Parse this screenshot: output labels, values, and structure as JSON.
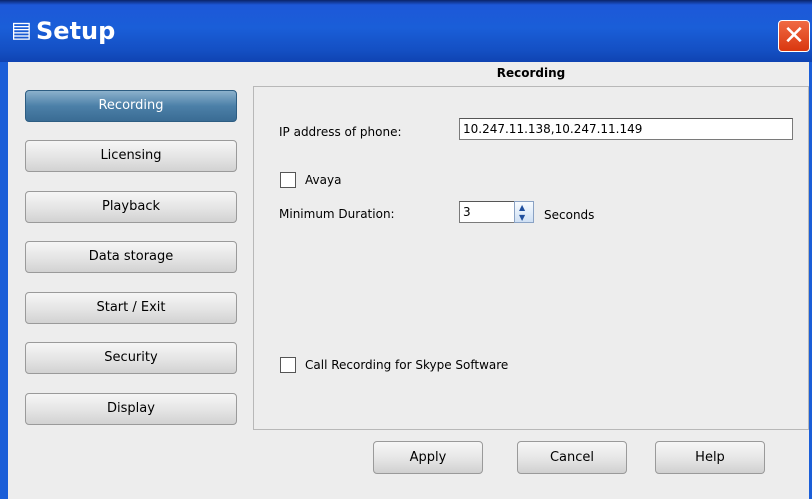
{
  "window": {
    "title": "Setup"
  },
  "nav": {
    "items": [
      {
        "id": "recording",
        "label": "Recording",
        "active": true
      },
      {
        "id": "licensing",
        "label": "Licensing"
      },
      {
        "id": "playback",
        "label": "Playback"
      },
      {
        "id": "data-storage",
        "label": "Data storage"
      },
      {
        "id": "start-exit",
        "label": "Start / Exit"
      },
      {
        "id": "security",
        "label": "Security"
      },
      {
        "id": "display",
        "label": "Display"
      }
    ]
  },
  "section": {
    "title": "Recording",
    "ip_label": "IP address of phone:",
    "ip_value": "10.247.11.138,10.247.11.149",
    "avaya_label": "Avaya",
    "avaya_checked": false,
    "min_duration_label": "Minimum Duration:",
    "min_duration_value": "3",
    "min_duration_unit": "Seconds",
    "skype_label": "Call Recording for Skype Software",
    "skype_checked": false
  },
  "footer": {
    "apply_label": "Apply",
    "cancel_label": "Cancel",
    "help_label": "Help"
  },
  "icons": {
    "title_icon": "setup-icon",
    "close": "close-icon",
    "spin_up": "spin-up-icon",
    "spin_down": "spin-down-icon"
  },
  "colors": {
    "titlebar": "#1a5ed8",
    "active_nav": "#4c80a8",
    "close_button": "#e1461b"
  }
}
